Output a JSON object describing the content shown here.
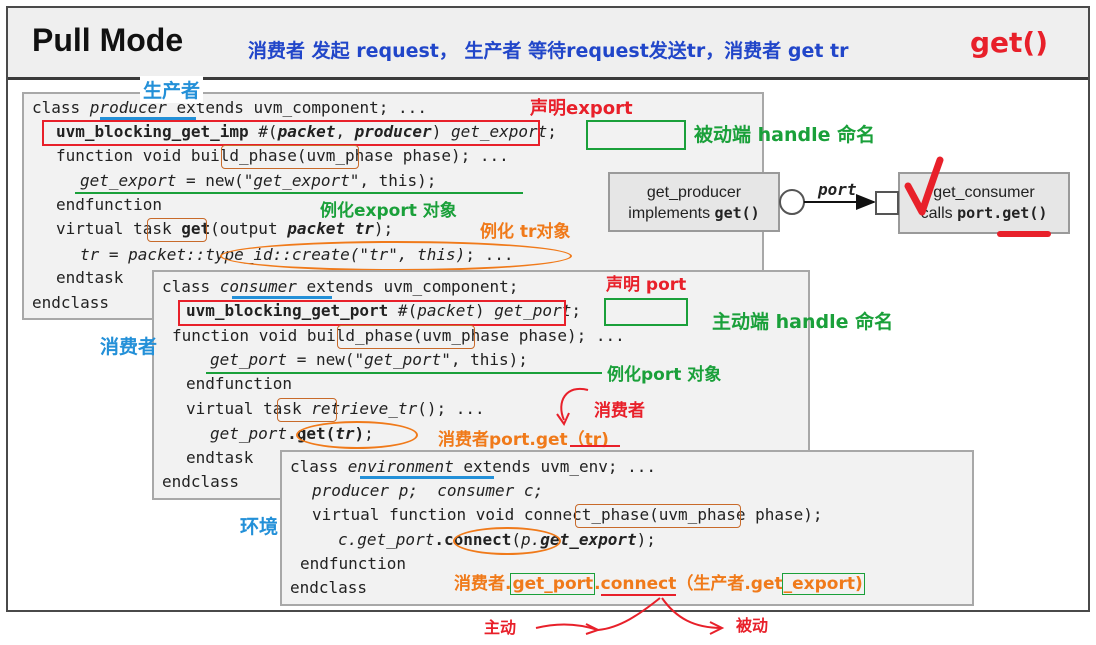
{
  "header": {
    "title": "Pull Mode",
    "subtitle": "消费者 发起 request， 生产者 等待request发送tr，消费者 get tr",
    "get_call": "get()"
  },
  "producer": {
    "label": "生产者",
    "lines": [
      "class producer extends uvm_component; ...",
      "uvm_blocking_get_imp #(packet, producer) get_export;",
      "function void build_phase(uvm_phase phase); ...",
      "get_export = new(\"get_export\", this);",
      "endfunction",
      "virtual task get(output packet tr);",
      "tr = packet::type_id::create(\"tr\", this); ...",
      "endtask",
      "endclass"
    ],
    "annotations": {
      "declare_export": "声明export",
      "passive_handle": "被动端 handle 命名",
      "instantiate_export": "例化export 对象",
      "instantiate_tr": "例化 tr对象"
    }
  },
  "consumer": {
    "label": "消费者",
    "lines": [
      "class consumer extends uvm_component;",
      "uvm_blocking_get_port #(packet) get_port;",
      "function void build_phase(uvm_phase phase); ...",
      "get_port = new(\"get_port\", this);",
      "endfunction",
      "virtual task retrieve_tr(); ...",
      "get_port.get(tr);",
      "endtask",
      "endclass"
    ],
    "annotations": {
      "declare_port": "声明 port",
      "active_handle": "主动端  handle 命名",
      "instantiate_port": "例化port 对象",
      "consumer_note": "消费者",
      "port_get": "消费者port.get（tr)"
    }
  },
  "environment": {
    "label": "环境",
    "lines": [
      "class environment extends uvm_env; ...",
      "producer p;  consumer c;",
      "virtual function void connect_phase(uvm_phase phase);",
      "c.get_port.connect(p.get_export);",
      "endfunction",
      "endclass"
    ],
    "annotations": {
      "connect_prefix": "消费者.",
      "connect_port": "get_port",
      "connect_dot": ".",
      "connect_word": "connect",
      "connect_mid": "（生产者.get",
      "connect_export": "_export)",
      "active": "主动",
      "passive": "被动"
    }
  },
  "diagram": {
    "producer_box": [
      "get_producer",
      "implements",
      "get()"
    ],
    "consumer_box": [
      "get_consumer",
      "calls",
      "port.get()"
    ],
    "connector_label": "port"
  },
  "colors": {
    "red": "#e8202a",
    "green": "#1aa03a",
    "orange": "#f07a1a",
    "blue_label": "#2390d8",
    "subtitle_blue": "#2146c9"
  }
}
